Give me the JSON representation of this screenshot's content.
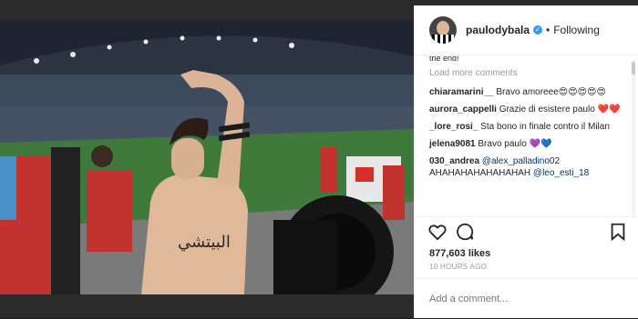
{
  "post": {
    "username": "paulodybala",
    "follow_status": "Following",
    "separator": "•",
    "verified_glyph": "✓",
    "tattoo_text": "البيتشي"
  },
  "comments": {
    "truncated_text": "the end!",
    "load_more": "Load more comments",
    "items": [
      {
        "user": "chiaramarini__",
        "text": "Bravo amoreee",
        "emoji": "😍😍😍😍😍"
      },
      {
        "user": "aurora_cappelli",
        "text": "Grazie di esistere paulo",
        "emoji": "❤️❤️"
      },
      {
        "user": "_lore_rosi_",
        "text": "Sta bono in finale contro il Milan",
        "emoji": ""
      },
      {
        "user": "jelena9081",
        "text": "Bravo paulo",
        "emoji": "💜💙"
      },
      {
        "user": "030_andrea",
        "mention": "@alex_palladino02",
        "text": "AHAHAHAHAHAHAHAH",
        "mention2": "@leo_esti_18"
      }
    ]
  },
  "actions": {
    "like_icon": "heart-outline-icon",
    "comment_icon": "comment-bubble-icon",
    "save_icon": "bookmark-icon"
  },
  "stats": {
    "likes": "877,603 likes",
    "time": "10 HOURS AGO"
  },
  "composer": {
    "placeholder": "Add a comment..."
  },
  "colors": {
    "accent": "#3897f0",
    "text": "#262626",
    "muted": "#999999",
    "heart": "#ed4956"
  }
}
